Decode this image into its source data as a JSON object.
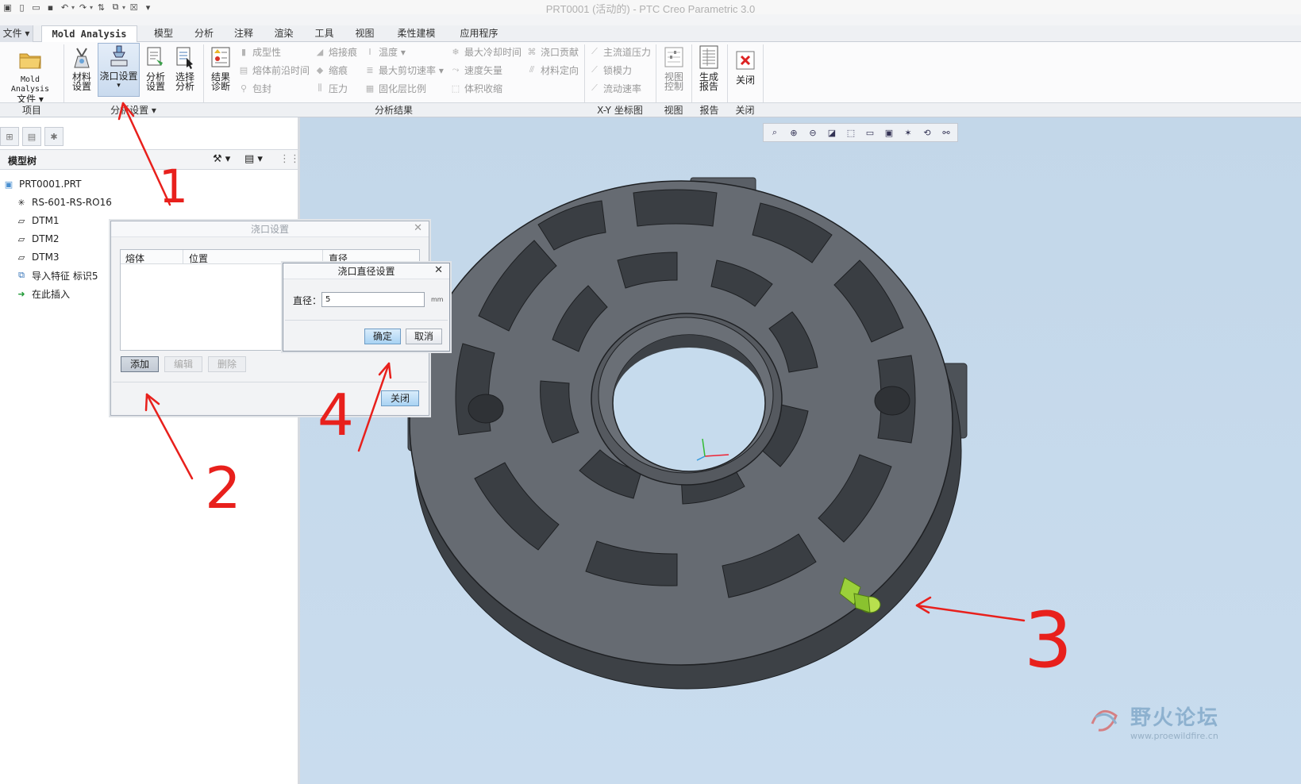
{
  "window": {
    "title": "PRT0001 (活动的) - PTC Creo Parametric 3.0"
  },
  "quick_access": {
    "icons": [
      "window-icon",
      "new-file-icon",
      "open-folder-icon",
      "save-icon",
      "undo-icon",
      "redo-icon",
      "regenerate-icon",
      "windows-icon",
      "close-window-icon",
      "customize-icon"
    ]
  },
  "tabs": [
    {
      "label": "文件 ▾",
      "id": "file"
    },
    {
      "label": "Mold Analysis",
      "id": "mold-analysis"
    },
    {
      "label": "模型",
      "id": "model"
    },
    {
      "label": "分析",
      "id": "analysis"
    },
    {
      "label": "注释",
      "id": "annotate"
    },
    {
      "label": "渲染",
      "id": "render"
    },
    {
      "label": "工具",
      "id": "tools"
    },
    {
      "label": "视图",
      "id": "view"
    },
    {
      "label": "柔性建模",
      "id": "flexible-modeling"
    },
    {
      "label": "应用程序",
      "id": "applications"
    }
  ],
  "ribbon": {
    "project": {
      "file_line1": "Mold Analysis",
      "file_line2": "文件 ▾"
    },
    "setup": {
      "material": [
        "材料",
        "设置"
      ],
      "gate": [
        "浇口设置",
        "▾"
      ],
      "analysis": [
        "分析",
        "设置"
      ],
      "select": [
        "选择",
        "分析"
      ]
    },
    "results": {
      "diagnose": [
        "结果",
        "诊断"
      ],
      "col1": [
        "成型性",
        "熔体前沿时间",
        "包封"
      ],
      "col2": [
        "熔接痕",
        "缩痕",
        "压力"
      ],
      "col3": [
        "温度 ▾",
        "最大剪切速率 ▾",
        "固化层比例"
      ],
      "col4": [
        "最大冷却时间",
        "速度矢量",
        "体积收缩"
      ],
      "col5": [
        "浇口贡献",
        "材料定向"
      ]
    },
    "xy": [
      "主流道压力",
      "锁模力",
      "流动速率"
    ],
    "view_btn": [
      "视图",
      "控制"
    ],
    "report_btn": [
      "生成",
      "报告"
    ],
    "close_btn": "关闭",
    "groups": {
      "project": "项目",
      "setup": "分析设置 ▾",
      "results": "分析结果",
      "xy": "X-Y 坐标图",
      "view": "视图",
      "report": "报告",
      "close": "关闭"
    }
  },
  "model_tree": {
    "title": "模型树",
    "items": [
      {
        "label": "PRT0001.PRT",
        "icon": "part-icon"
      },
      {
        "label": "RS-601-RS-RO16",
        "icon": "csys-icon"
      },
      {
        "label": "DTM1",
        "icon": "datum-plane-icon"
      },
      {
        "label": "DTM2",
        "icon": "datum-plane-icon"
      },
      {
        "label": "DTM3",
        "icon": "datum-plane-icon"
      },
      {
        "label": "导入特征 标识5",
        "icon": "import-feature-icon"
      },
      {
        "label": "在此插入",
        "icon": "insert-here-arrow-icon"
      }
    ]
  },
  "gate_dialog": {
    "title": "浇口设置",
    "columns": [
      "熔体",
      "位置",
      "直径"
    ],
    "add": "添加",
    "edit": "编辑",
    "delete": "删除",
    "close": "关闭"
  },
  "diameter_dialog": {
    "title": "浇口直径设置",
    "label": "直径：",
    "value": "5",
    "unit": "mm",
    "ok": "确定",
    "cancel": "取消"
  },
  "annotations": [
    "1",
    "2",
    "3",
    "4"
  ],
  "watermark": {
    "text": "野火论坛",
    "url": "www.proewildfire.cn"
  },
  "colors": {
    "part": "#5c6168",
    "part_dark": "#3e4248",
    "gate_marker": "#9bd13a",
    "annotation": "#e8201c",
    "viewport": "#c6dbed"
  }
}
